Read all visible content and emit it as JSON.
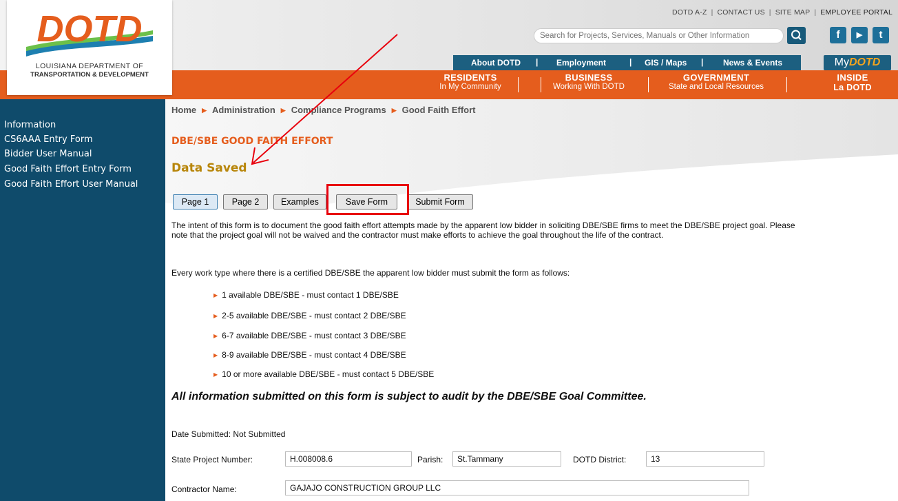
{
  "header": {
    "logo": {
      "text": "DOTD",
      "line1": "LOUISIANA DEPARTMENT OF",
      "line2": "TRANSPORTATION & DEVELOPMENT"
    },
    "utility_links": [
      "DOTD A-Z",
      "CONTACT US",
      "SITE MAP",
      "EMPLOYEE PORTAL"
    ],
    "separator": "|",
    "search_placeholder": "Search for Projects, Services, Manuals or Other Information",
    "social": {
      "facebook": "f",
      "youtube": "▶",
      "twitter": "t"
    },
    "nav_blue": [
      "About DOTD",
      "Employment",
      "GIS / Maps",
      "News & Events"
    ],
    "my_dotd": {
      "my": "My",
      "dotd": "DOTD"
    },
    "nav_orange": [
      {
        "title": "RESIDENTS",
        "sub": "In My Community"
      },
      {
        "title": "BUSINESS",
        "sub": "Working With DOTD"
      },
      {
        "title": "GOVERNMENT",
        "sub": "State and Local Resources"
      },
      {
        "title": "INSIDE",
        "sub": "La DOTD"
      }
    ]
  },
  "sidebar": {
    "items": [
      "Information",
      "CS6AAA Entry Form",
      "Bidder User Manual",
      "Good Faith Effort Entry Form",
      "Good Faith Effort User Manual"
    ]
  },
  "breadcrumb": [
    "Home",
    "Administration",
    "Compliance Programs",
    "Good Faith Effort"
  ],
  "main": {
    "form_title": "DBE/SBE GOOD FAITH EFFORT",
    "status": "Data Saved",
    "buttons": [
      "Page 1",
      "Page 2",
      "Examples",
      "Save Form",
      "Submit Form"
    ],
    "intro": "The intent of this form is to document the good faith effort attempts made by the apparent low bidder in soliciting DBE/SBE firms to meet the DBE/SBE project goal. Please note that the project goal will not be waived and the contractor must make efforts to achieve the goal throughout the life of the contract.",
    "rule": "Every work type where there is a certified DBE/SBE the apparent low bidder must submit the form as follows:",
    "bullets": [
      "1 available DBE/SBE - must contact 1 DBE/SBE",
      "2-5 available DBE/SBE - must contact 2 DBE/SBE",
      "6-7 available DBE/SBE - must contact 3 DBE/SBE",
      "8-9 available DBE/SBE - must contact 4 DBE/SBE",
      "10 or more available DBE/SBE - must contact 5 DBE/SBE"
    ],
    "audit": "All information submitted on this form is subject to audit by the DBE/SBE Goal Committee.",
    "date_submitted": "Date Submitted: Not Submitted",
    "fields": {
      "state_project_label": "State Project Number:",
      "state_project_value": "H.008008.6",
      "parish_label": "Parish:",
      "parish_value": "St.Tammany",
      "district_label": "DOTD District:",
      "district_value": "13",
      "contractor_label": "Contractor Name:",
      "contractor_value": "GAJAJO CONSTRUCTION GROUP LLC"
    }
  },
  "colors": {
    "orange": "#e55d1d",
    "navy": "#0f4b6b",
    "blue": "#1c5f80",
    "gold": "#b8860b",
    "annotation_red": "#e8000d"
  }
}
